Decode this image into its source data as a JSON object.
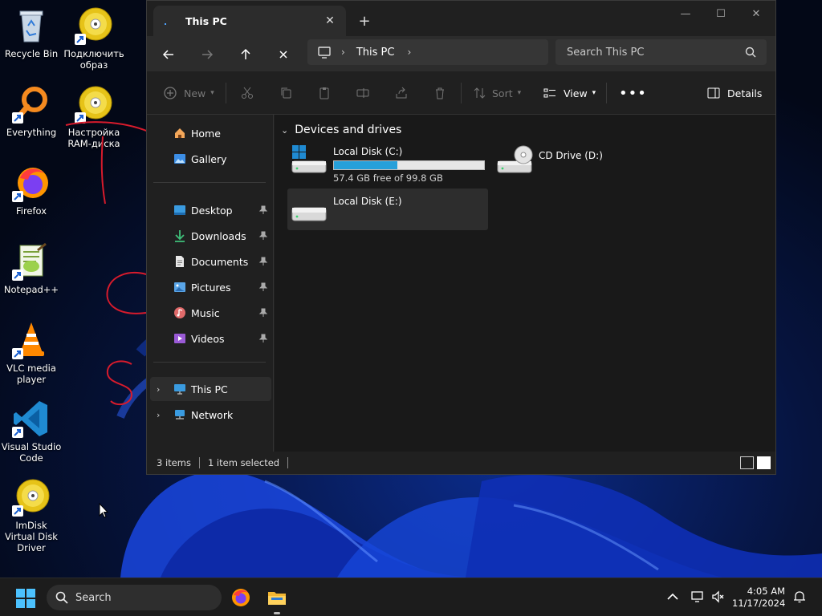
{
  "desktop": {
    "icons": [
      {
        "label": "Recycle Bin",
        "icon": "recycle-bin-icon"
      },
      {
        "label": "Подключить образ",
        "icon": "disc-icon"
      },
      {
        "label": "Everything",
        "icon": "magnifier-icon"
      },
      {
        "label": "Настройка RAM-диска",
        "icon": "disc-icon"
      },
      {
        "label": "Firefox",
        "icon": "firefox-icon"
      },
      {
        "label": "Notepad++",
        "icon": "notepad-icon"
      },
      {
        "label": "VLC media player",
        "icon": "vlc-icon"
      },
      {
        "label": "Visual Studio Code",
        "icon": "vscode-icon"
      },
      {
        "label": "ImDisk Virtual Disk Driver",
        "icon": "disc-icon"
      }
    ]
  },
  "explorer": {
    "tab_title": "This PC",
    "address": {
      "segments": [
        "This PC"
      ]
    },
    "search_placeholder": "Search This PC",
    "commands": {
      "new": "New",
      "sort": "Sort",
      "view": "View",
      "details": "Details"
    },
    "nav": {
      "home": "Home",
      "gallery": "Gallery",
      "desktop": "Desktop",
      "downloads": "Downloads",
      "documents": "Documents",
      "pictures": "Pictures",
      "music": "Music",
      "videos": "Videos",
      "this_pc": "This PC",
      "network": "Network"
    },
    "group_header": "Devices and drives",
    "drives": [
      {
        "name": "Local Disk (C:)",
        "free_text": "57.4 GB free of 99.8 GB",
        "used_fraction": 0.425
      },
      {
        "name": "CD Drive (D:)"
      },
      {
        "name": "Local Disk (E:)"
      }
    ],
    "status": {
      "items": "3 items",
      "selected": "1 item selected"
    }
  },
  "taskbar": {
    "search_label": "Search",
    "time": "4:05 AM",
    "date": "11/17/2024"
  },
  "colors": {
    "accent": "#26a0da",
    "window_bg": "#202020",
    "content_bg": "#191919",
    "annotation": "#d81b2c"
  }
}
